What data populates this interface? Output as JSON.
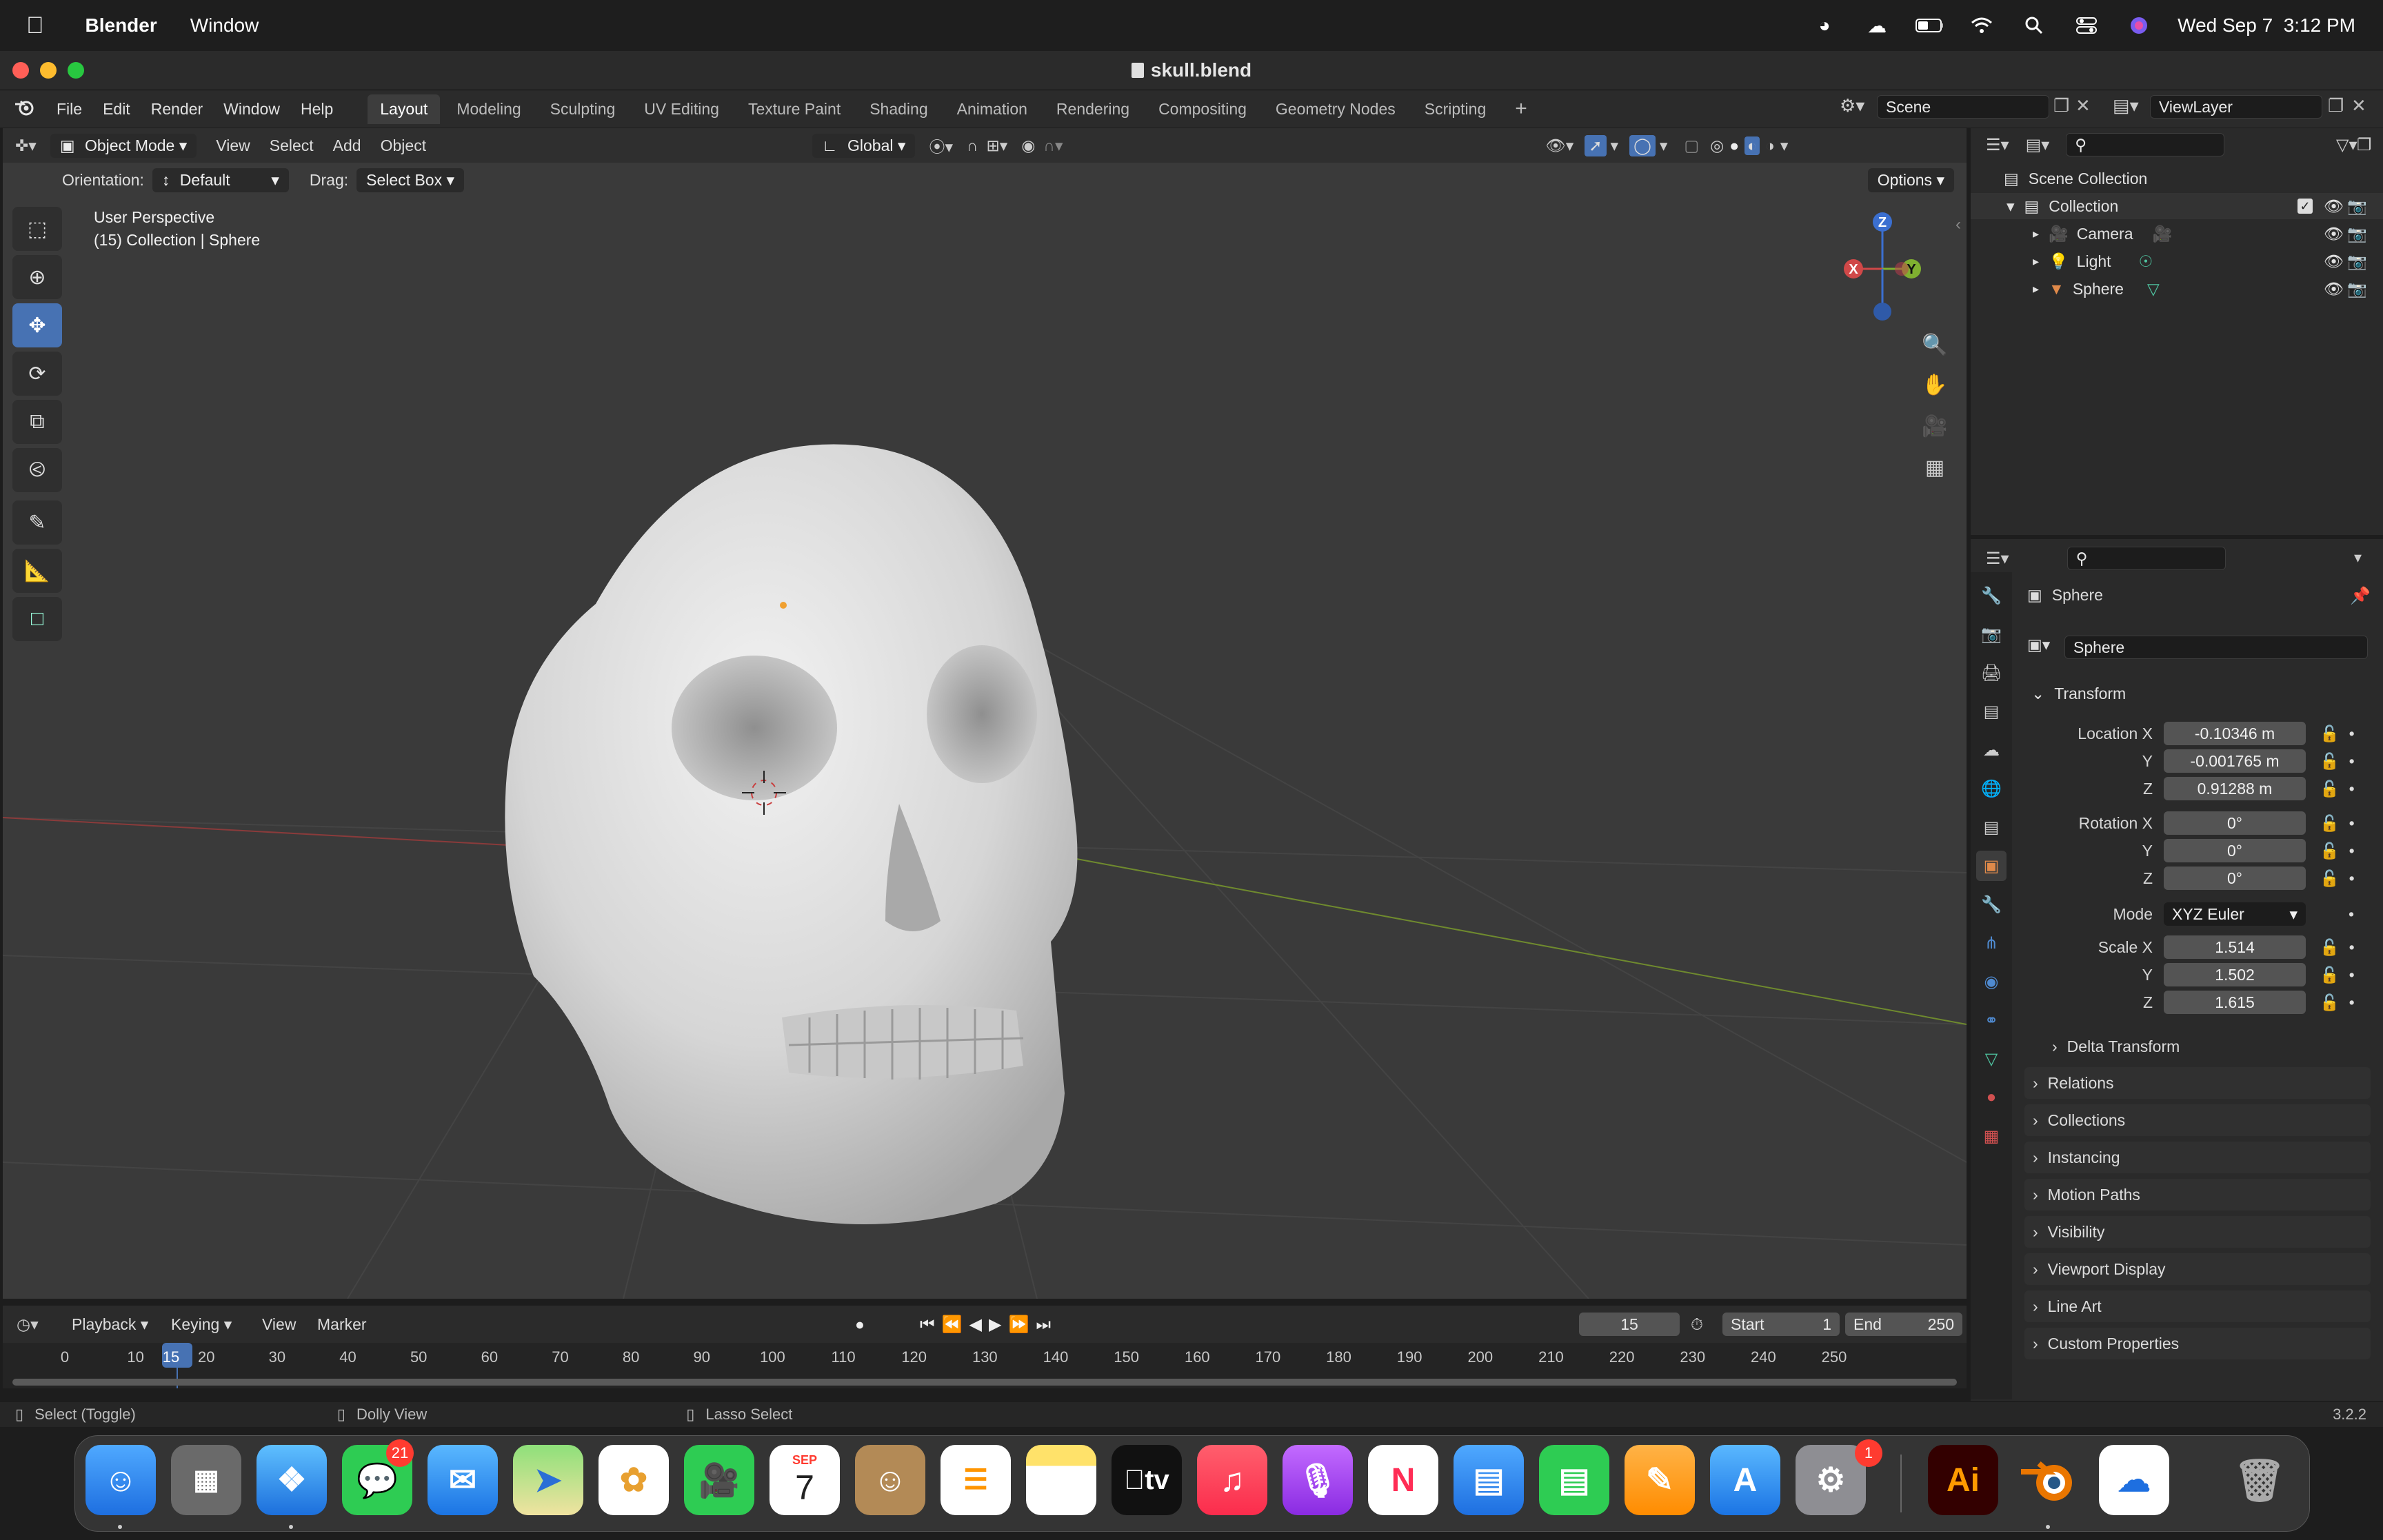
{
  "mac_menubar": {
    "app_name": "Blender",
    "menu_items": [
      "Window"
    ],
    "datetime": "Wed Sep 7  3:12 PM"
  },
  "window": {
    "title": "skull.blend"
  },
  "blender_menu": [
    "File",
    "Edit",
    "Render",
    "Window",
    "Help"
  ],
  "workspace_tabs": [
    "Layout",
    "Modeling",
    "Sculpting",
    "UV Editing",
    "Texture Paint",
    "Shading",
    "Animation",
    "Rendering",
    "Compositing",
    "Geometry Nodes",
    "Scripting"
  ],
  "active_workspace": "Layout",
  "scene_field": "Scene",
  "viewlayer_field": "ViewLayer",
  "viewport_header": {
    "mode": "Object Mode",
    "menus": [
      "View",
      "Select",
      "Add",
      "Object"
    ],
    "transform_orientation": "Global"
  },
  "tool_settings": {
    "orientation_label": "Orientation:",
    "orientation_value": "Default",
    "drag_label": "Drag:",
    "drag_value": "Select Box",
    "options_label": "Options"
  },
  "viewport_overlay": {
    "line1": "User Perspective",
    "line2": "(15) Collection | Sphere"
  },
  "gizmo": {
    "x": "X",
    "y": "Y",
    "z": "Z"
  },
  "outliner": {
    "scene_collection": "Scene Collection",
    "collection": "Collection",
    "objects": [
      "Camera",
      "Light",
      "Sphere"
    ]
  },
  "properties": {
    "object_name": "Sphere",
    "data_name": "Sphere",
    "transform_panel": "Transform",
    "location_label": "Location X",
    "location": [
      "-0.10346 m",
      "-0.001765 m",
      "0.91288 m"
    ],
    "rotation_label": "Rotation X",
    "rotation": [
      "0°",
      "0°",
      "0°"
    ],
    "mode_label": "Mode",
    "mode_value": "XYZ Euler",
    "scale_label": "Scale X",
    "scale": [
      "1.514",
      "1.502",
      "1.615"
    ],
    "axis_y": "Y",
    "axis_z": "Z",
    "delta_transform": "Delta Transform",
    "panels": [
      "Relations",
      "Collections",
      "Instancing",
      "Motion Paths",
      "Visibility",
      "Viewport Display",
      "Line Art",
      "Custom Properties"
    ]
  },
  "timeline": {
    "menus": [
      "Playback",
      "Keying",
      "View",
      "Marker"
    ],
    "current_frame": "15",
    "start_label": "Start",
    "start_value": "1",
    "end_label": "End",
    "end_value": "250",
    "ticks": [
      "0",
      "10",
      "15",
      "20",
      "30",
      "40",
      "50",
      "60",
      "70",
      "80",
      "90",
      "100",
      "110",
      "120",
      "130",
      "140",
      "150",
      "160",
      "170",
      "180",
      "190",
      "200",
      "210",
      "220",
      "230",
      "240",
      "250"
    ]
  },
  "statusbar": {
    "select": "Select (Toggle)",
    "dolly": "Dolly View",
    "lasso": "Lasso Select",
    "version": "3.2.2"
  },
  "dock": {
    "messages_badge": "21",
    "calendar_month": "SEP",
    "calendar_day": "7",
    "settings_badge": "1",
    "illustrator_label": "Ai",
    "tv_label": "tv"
  }
}
